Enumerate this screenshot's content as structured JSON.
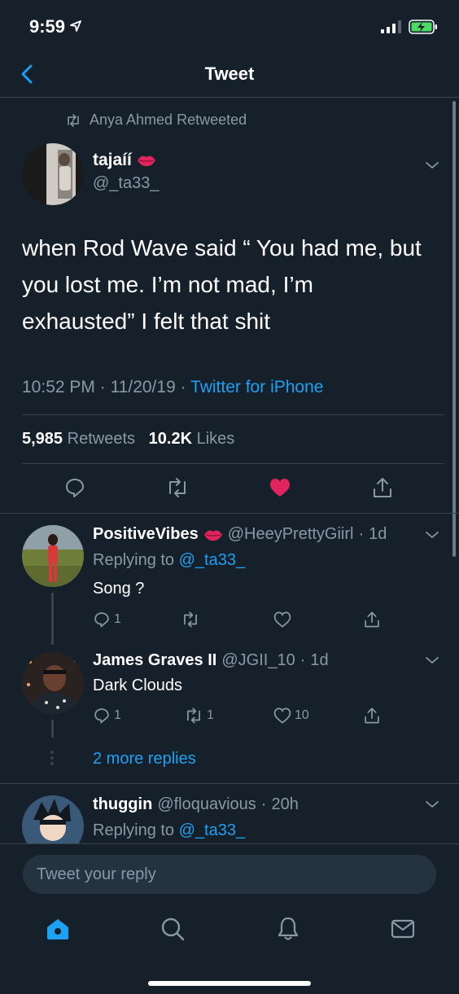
{
  "status_bar": {
    "time": "9:59"
  },
  "nav": {
    "title": "Tweet"
  },
  "tweet": {
    "retweeted_by": "Anya Ahmed Retweeted",
    "author_name": "tajaíí",
    "author_handle": "@_ta33_",
    "text": "when Rod Wave said “ You had me, but you lost me. I’m not mad, I’m exhausted” I felt that shit",
    "time": "10:52 PM",
    "date": "11/20/19",
    "source": "Twitter for iPhone",
    "retweets_count": "5,985",
    "retweets_label": "Retweets",
    "likes_count": "10.2K",
    "likes_label": "Likes",
    "liked": true
  },
  "replies": [
    {
      "name": "PositiveVibes",
      "handle": "@HeeyPrettyGiirl",
      "age": "1d",
      "replying_prefix": "Replying to",
      "replying_to": "@_ta33_",
      "text": "Song ?",
      "reply_count": "1",
      "retweet_count": "",
      "like_count": ""
    },
    {
      "name": "James Graves II",
      "handle": "@JGII_10",
      "age": "1d",
      "text": "Dark Clouds",
      "reply_count": "1",
      "retweet_count": "1",
      "like_count": "10"
    },
    {
      "name": "thuggin",
      "handle": "@floquavious",
      "age": "20h",
      "replying_prefix": "Replying to",
      "replying_to": "@_ta33_"
    }
  ],
  "more_replies": "2 more replies",
  "composer": {
    "placeholder": "Tweet your reply"
  },
  "tab_bar": [
    "home-icon",
    "search-icon",
    "notifications-icon",
    "messages-icon"
  ],
  "colors": {
    "background": "#15202b",
    "accent": "#1da1f2",
    "like": "#e0245e",
    "muted": "#8899a6",
    "divider": "#38444d"
  }
}
